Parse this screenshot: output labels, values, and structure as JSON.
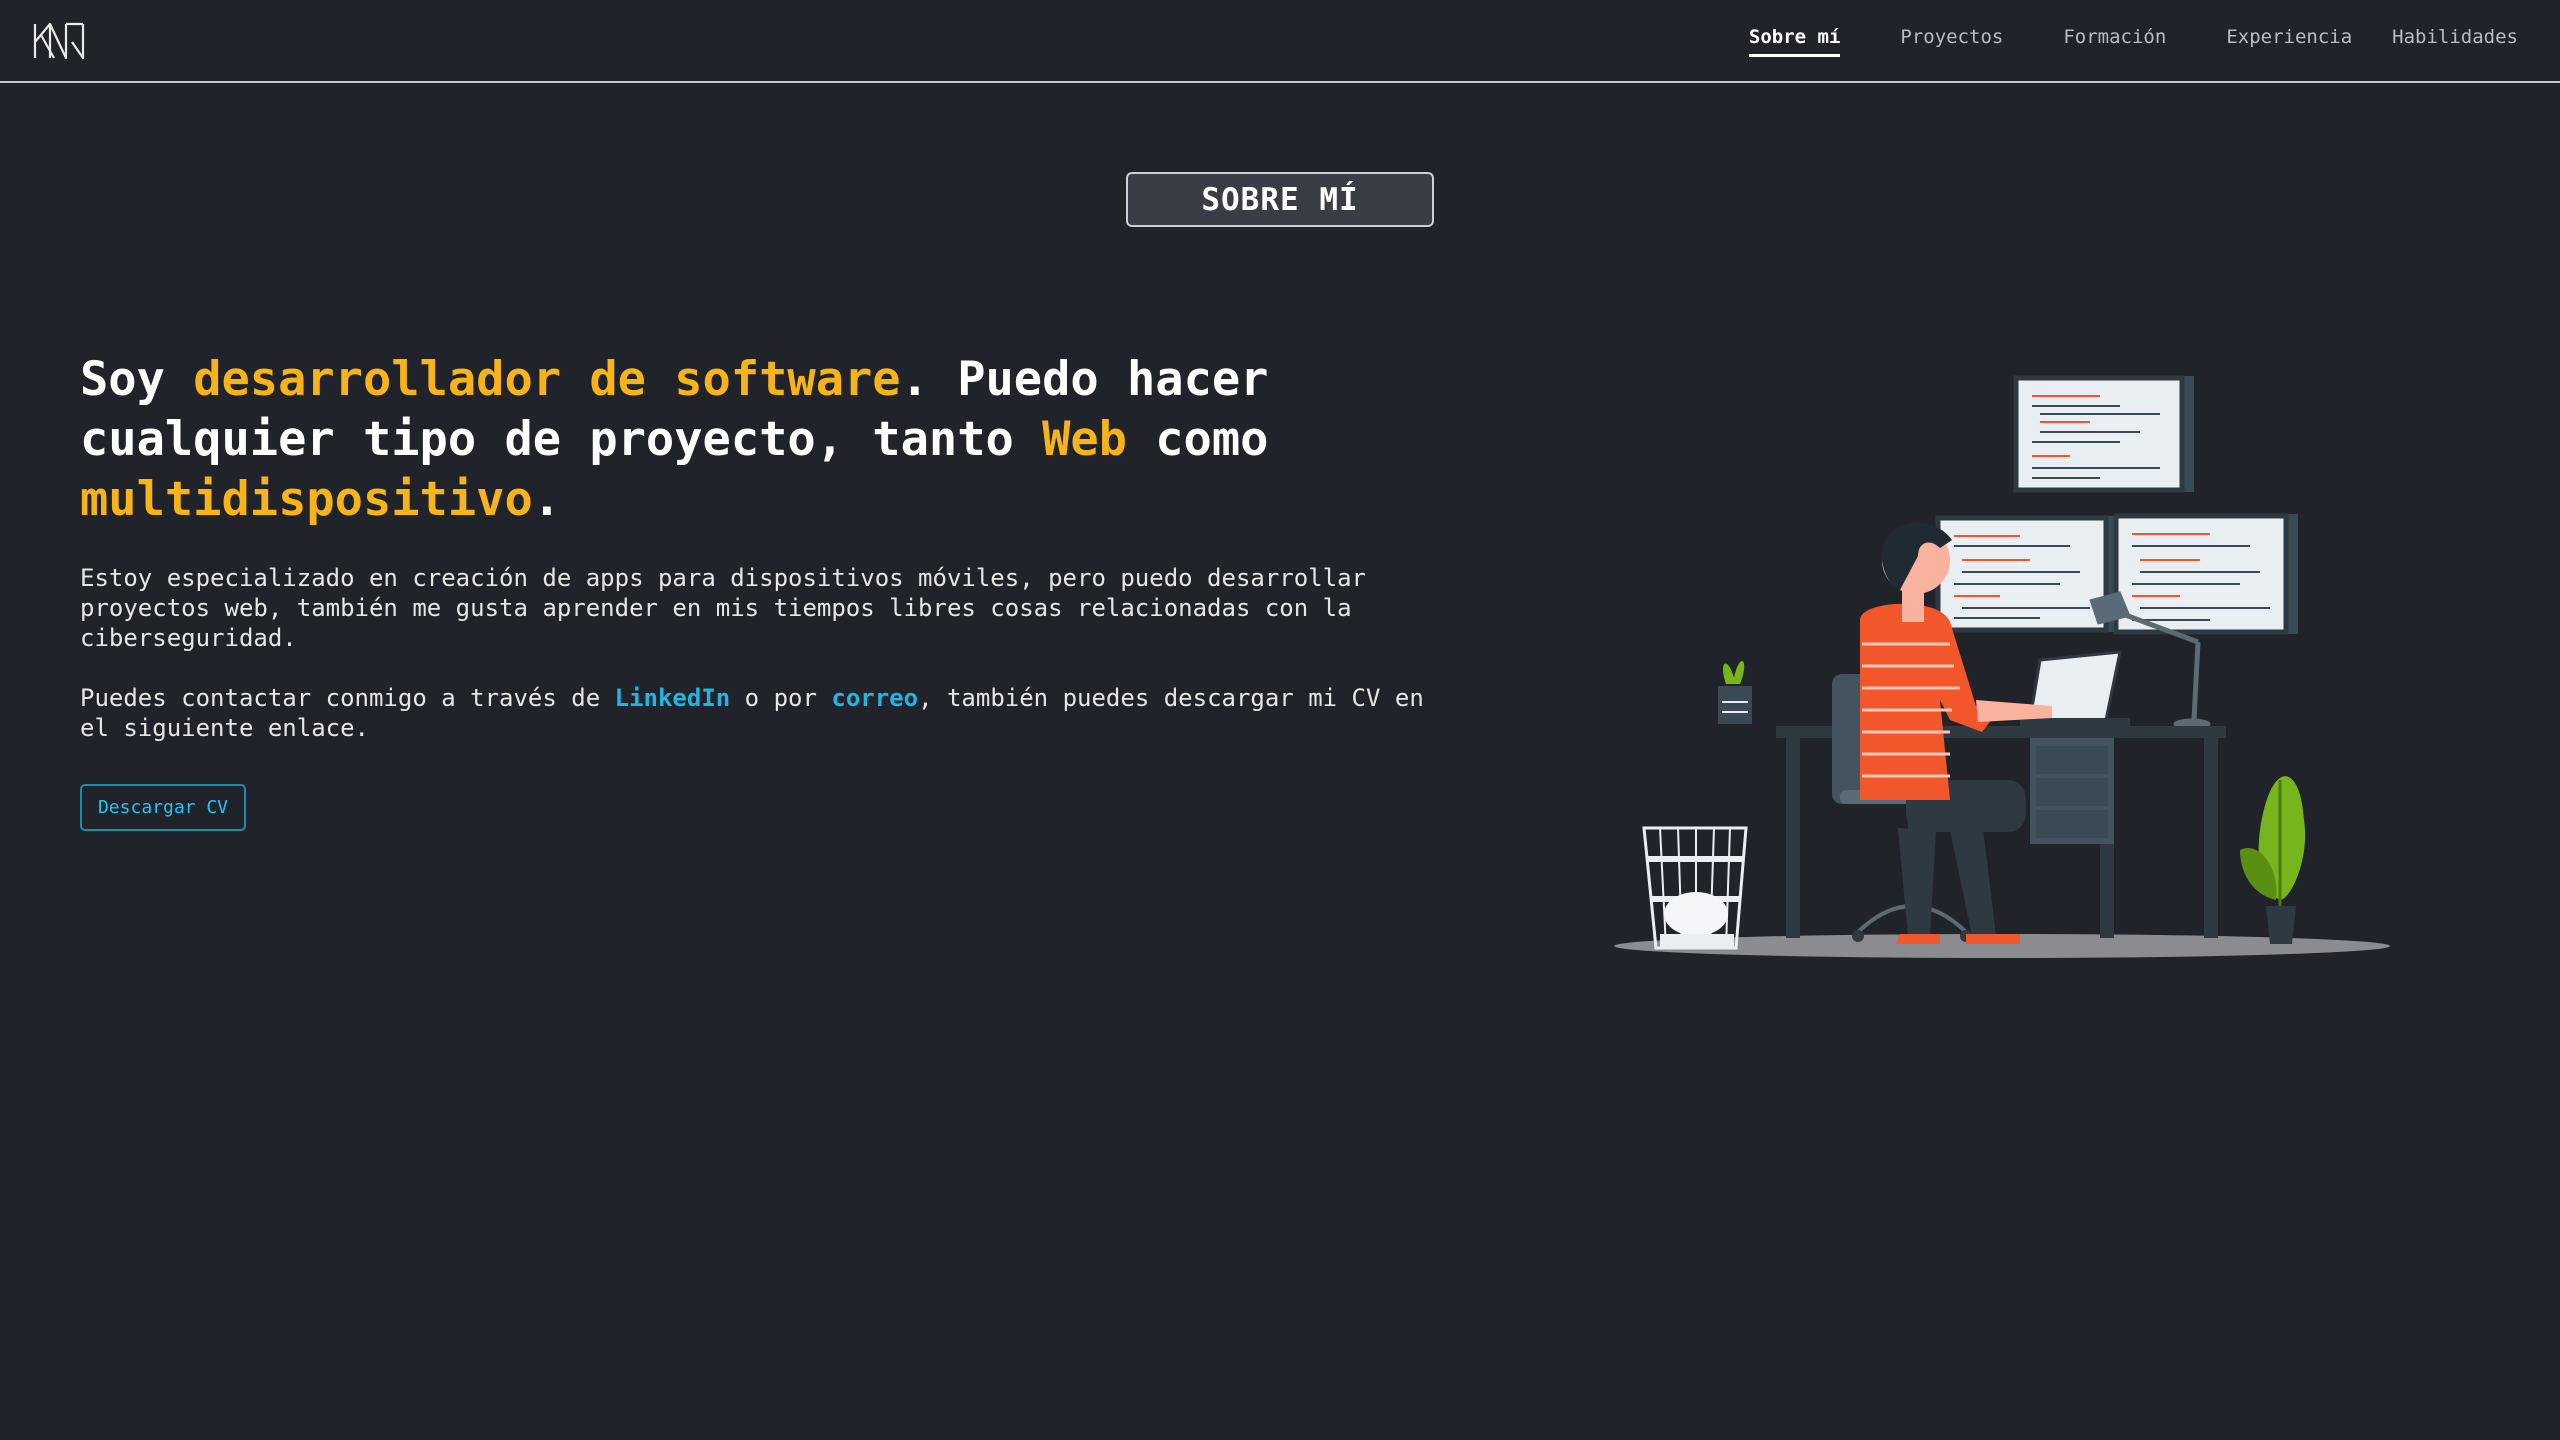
{
  "header": {
    "logo_alt": "KN",
    "nav": [
      {
        "label": "Sobre mí",
        "active": true
      },
      {
        "label": "Proyectos",
        "active": false
      },
      {
        "label": "Formación",
        "active": false
      },
      {
        "label": "Experiencia",
        "active": false
      },
      {
        "label": "Habilidades",
        "active": false
      }
    ]
  },
  "section": {
    "badge": "SOBRE MÍ"
  },
  "hero": {
    "headline": {
      "p1": "Soy ",
      "h1": "desarrollador de software",
      "p2": ". Puedo hacer cualquier tipo de proyecto, tanto ",
      "h2": "Web",
      "p3": " como ",
      "h3": "multidispositivo",
      "p4": "."
    },
    "paragraph1": "Estoy especializado en creación de apps para dispositivos móviles, pero puedo desarrollar proyectos web, también me gusta aprender en mis tiempos libres cosas relacionadas con la ciberseguridad.",
    "paragraph2": {
      "p1": "Puedes contactar conmigo a través de ",
      "link1": "LinkedIn",
      "p2": " o por ",
      "link2": "correo",
      "p3": ", también puedes descargar mi CV en el siguiente enlace."
    },
    "cv_button": "Descargar CV"
  },
  "colors": {
    "background": "#21232a",
    "highlight": "#f6b417",
    "link": "#1fb6e4",
    "shirt": "#f2572b"
  },
  "illustration": {
    "name": "developer-at-desk-illustration"
  }
}
